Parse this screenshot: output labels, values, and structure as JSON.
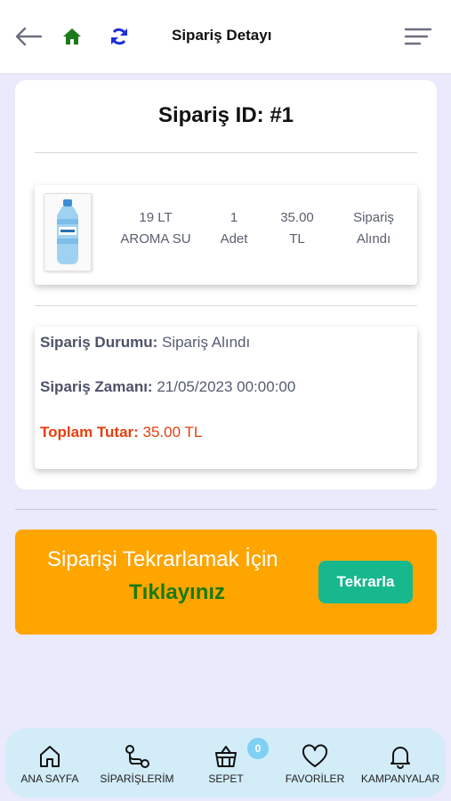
{
  "header": {
    "title": "Sipariş Detayı",
    "icons": [
      "back-arrow-icon",
      "home-icon",
      "refresh-icon",
      "menu-icon"
    ],
    "colors": {
      "home": "#1d7a1b",
      "refresh": "#1d2fd6"
    }
  },
  "order": {
    "id_label": "Sipariş ID: #1",
    "product": {
      "name_line1": "19 LT",
      "name_line2": "AROMA SU",
      "qty_line1": "1",
      "qty_line2": "Adet",
      "price_line1": "35.00",
      "price_line2": "TL",
      "status_line1": "Sipariş",
      "status_line2": "Alındı"
    },
    "details": {
      "status_label": "Sipariş Durumu:",
      "status_value": "Sipariş Alındı",
      "time_label": "Sipariş Zamanı:",
      "time_value": "21/05/2023 00:00:00",
      "total_label": "Toplam Tutar:",
      "total_value": "35.00 TL"
    }
  },
  "repeat": {
    "line1": "Siparişi Tekrarlamak İçin",
    "line2": "Tıklayınız",
    "button_label": "Tekrarla",
    "colors": {
      "banner": "#fea500",
      "button": "#17b88e",
      "accent_text": "#1a7a10"
    }
  },
  "bottom_nav": {
    "items": [
      {
        "label": "ANA SAYFA",
        "icon": "home-outline-icon"
      },
      {
        "label": "SİPARİŞLERİM",
        "icon": "route-icon"
      },
      {
        "label": "SEPET",
        "icon": "basket-icon"
      },
      {
        "label": "FAVORİLER",
        "icon": "heart-icon"
      },
      {
        "label": "KAMPANYALAR",
        "icon": "bell-icon"
      }
    ],
    "cart_badge": "0"
  }
}
